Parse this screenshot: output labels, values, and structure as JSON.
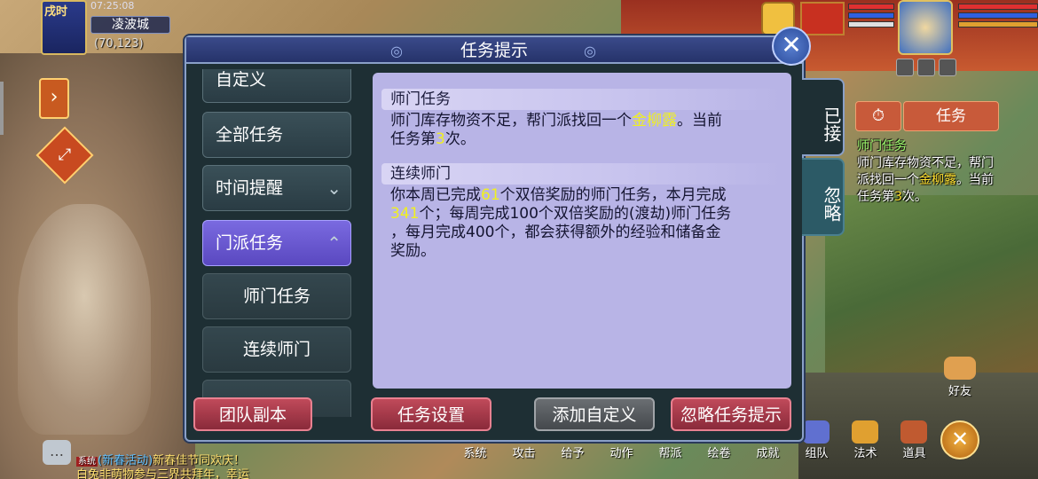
{
  "location": {
    "time_tag": "戌时",
    "clock": "07:25:08",
    "city": "凌波城",
    "coords": "(70,123)"
  },
  "dialog": {
    "title": "任务提示",
    "categories": [
      {
        "label": "自定义"
      },
      {
        "label": "全部任务"
      },
      {
        "label": "时间提醒"
      },
      {
        "label": "门派任务"
      },
      {
        "label": "师门任务"
      },
      {
        "label": "连续师门"
      }
    ],
    "sections": [
      {
        "title": "师门任务",
        "text_parts": [
          "师门库存物资不足，帮门派找回一个",
          "金柳露",
          "。当前",
          "任务第",
          "3",
          "次。"
        ]
      },
      {
        "title": "连续师门",
        "text_parts": [
          "你本周已完成",
          "61",
          "个双倍奖励的师门任务，本月完成",
          "341",
          "个；每周完成100个双倍奖励的(渡劫)师门任务",
          "，每月完成400个，都会获得额外的经验和储备金",
          "奖励。"
        ]
      }
    ],
    "side_tabs": [
      "已接",
      "忽略"
    ],
    "buttons": {
      "team_dungeon": "团队副本",
      "task_settings": "任务设置",
      "add_custom": "添加自定义",
      "ignore_tips": "忽略任务提示"
    }
  },
  "tracker": {
    "tab": "任务",
    "timer_icon": "⏱",
    "title": "师门任务",
    "text_parts": [
      "师门库存物资不足，帮门派找回一个",
      "金柳露",
      "。当前任务第",
      "3",
      "次。"
    ]
  },
  "chat": {
    "tag": "系统",
    "line1_blue": "(新春活动)",
    "line1_rest": "新春佳节同欢庆！",
    "line2": "白兔非萌物参与三界共拜年，幸运"
  },
  "bottom_menu": [
    "系统",
    "攻击",
    "给予",
    "动作",
    "帮派",
    "绘卷",
    "成就",
    "组队",
    "法术",
    "道具"
  ],
  "friend_label": "好友",
  "colors": {
    "highlight": "#f0f020",
    "dialog_bg": "#1e2f34",
    "content_bg": "#b8b4e6",
    "active_tab": "#6a58d0",
    "red_button": "#a03a4a"
  }
}
